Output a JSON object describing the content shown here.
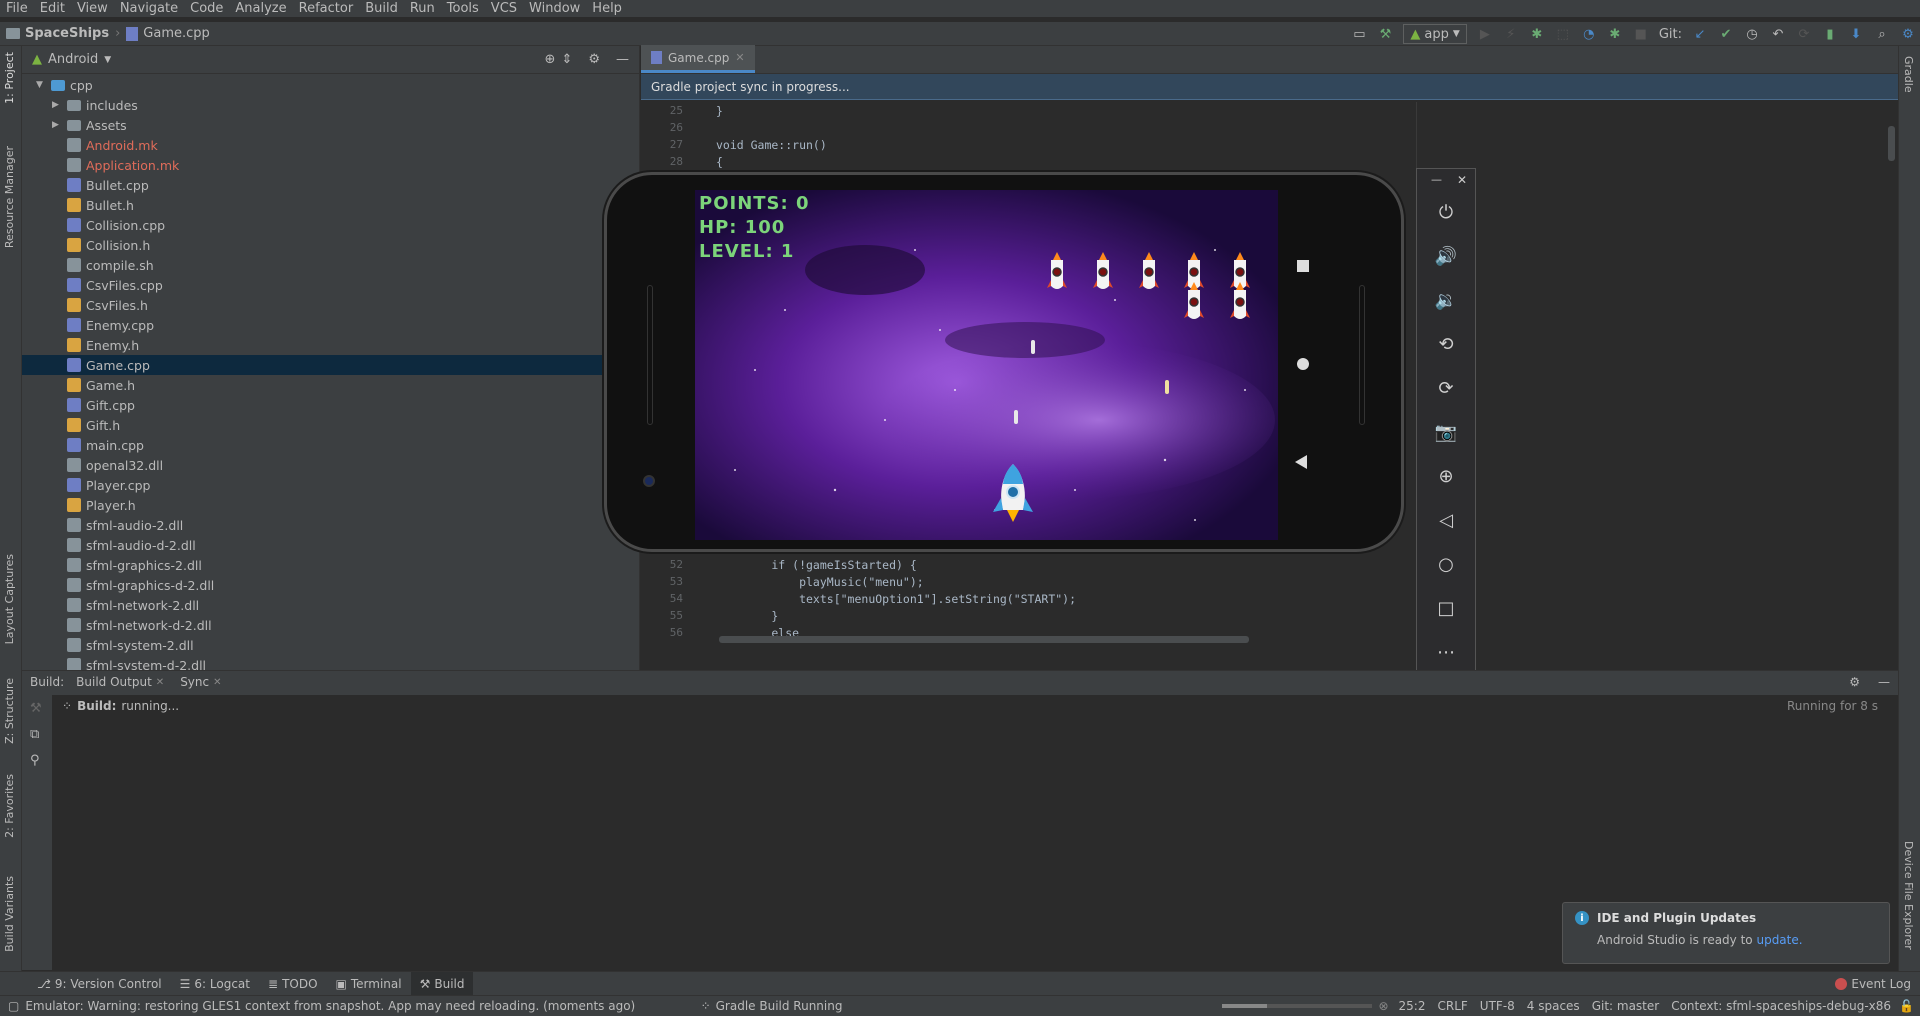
{
  "menu": [
    "File",
    "Edit",
    "View",
    "Navigate",
    "Code",
    "Analyze",
    "Refactor",
    "Build",
    "Run",
    "Tools",
    "VCS",
    "Window",
    "Help"
  ],
  "breadcrumb": {
    "project": "SpaceShips",
    "file": "Game.cpp"
  },
  "toolbar": {
    "run_config": "app",
    "git_label": "Git:"
  },
  "left_tabs": {
    "project": "1: Project",
    "resource_manager": "Resource Manager",
    "layout_captures": "Layout Captures",
    "structure": "Z: Structure",
    "favorites": "2: Favorites",
    "build_variants": "Build Variants"
  },
  "right_tabs": {
    "gradle": "Gradle",
    "device_file_explorer": "Device File Explorer"
  },
  "project": {
    "view_selector": "Android",
    "tree": [
      {
        "label": "cpp",
        "kind": "folder-open",
        "depth": 0,
        "color": "#bbbbbb"
      },
      {
        "label": "includes",
        "kind": "folder",
        "depth": 1,
        "color": "#bbbbbb"
      },
      {
        "label": "Assets",
        "kind": "folder",
        "depth": 1,
        "color": "#bbbbbb"
      },
      {
        "label": "Android.mk",
        "kind": "file",
        "depth": 1,
        "color": "#e06c5a"
      },
      {
        "label": "Application.mk",
        "kind": "file",
        "depth": 1,
        "color": "#e06c5a"
      },
      {
        "label": "Bullet.cpp",
        "kind": "cpp",
        "depth": 1,
        "color": "#bbbbbb"
      },
      {
        "label": "Bullet.h",
        "kind": "h",
        "depth": 1,
        "color": "#bbbbbb"
      },
      {
        "label": "Collision.cpp",
        "kind": "cpp",
        "depth": 1,
        "color": "#bbbbbb"
      },
      {
        "label": "Collision.h",
        "kind": "h",
        "depth": 1,
        "color": "#bbbbbb"
      },
      {
        "label": "compile.sh",
        "kind": "file",
        "depth": 1,
        "color": "#bbbbbb"
      },
      {
        "label": "CsvFiles.cpp",
        "kind": "cpp",
        "depth": 1,
        "color": "#bbbbbb"
      },
      {
        "label": "CsvFiles.h",
        "kind": "h",
        "depth": 1,
        "color": "#bbbbbb"
      },
      {
        "label": "Enemy.cpp",
        "kind": "cpp",
        "depth": 1,
        "color": "#bbbbbb"
      },
      {
        "label": "Enemy.h",
        "kind": "h",
        "depth": 1,
        "color": "#bbbbbb"
      },
      {
        "label": "Game.cpp",
        "kind": "cpp",
        "depth": 1,
        "color": "#bbbbbb",
        "selected": true
      },
      {
        "label": "Game.h",
        "kind": "h",
        "depth": 1,
        "color": "#bbbbbb"
      },
      {
        "label": "Gift.cpp",
        "kind": "cpp",
        "depth": 1,
        "color": "#bbbbbb"
      },
      {
        "label": "Gift.h",
        "kind": "h",
        "depth": 1,
        "color": "#bbbbbb"
      },
      {
        "label": "main.cpp",
        "kind": "cpp",
        "depth": 1,
        "color": "#bbbbbb"
      },
      {
        "label": "openal32.dll",
        "kind": "file",
        "depth": 1,
        "color": "#bbbbbb"
      },
      {
        "label": "Player.cpp",
        "kind": "cpp",
        "depth": 1,
        "color": "#bbbbbb"
      },
      {
        "label": "Player.h",
        "kind": "h",
        "depth": 1,
        "color": "#bbbbbb"
      },
      {
        "label": "sfml-audio-2.dll",
        "kind": "file",
        "depth": 1,
        "color": "#bbbbbb"
      },
      {
        "label": "sfml-audio-d-2.dll",
        "kind": "file",
        "depth": 1,
        "color": "#bbbbbb"
      },
      {
        "label": "sfml-graphics-2.dll",
        "kind": "file",
        "depth": 1,
        "color": "#bbbbbb"
      },
      {
        "label": "sfml-graphics-d-2.dll",
        "kind": "file",
        "depth": 1,
        "color": "#bbbbbb"
      },
      {
        "label": "sfml-network-2.dll",
        "kind": "file",
        "depth": 1,
        "color": "#bbbbbb"
      },
      {
        "label": "sfml-network-d-2.dll",
        "kind": "file",
        "depth": 1,
        "color": "#bbbbbb"
      },
      {
        "label": "sfml-system-2.dll",
        "kind": "file",
        "depth": 1,
        "color": "#bbbbbb"
      },
      {
        "label": "sfml-system-d-2.dll",
        "kind": "file",
        "depth": 1,
        "color": "#bbbbbb"
      }
    ]
  },
  "editor": {
    "tab": "Game.cpp",
    "sync_message": "Gradle project sync in progress...",
    "lines_top": [
      {
        "n": "25",
        "code": "}"
      },
      {
        "n": "26",
        "code": ""
      },
      {
        "n": "27",
        "code": "void Game::run()"
      },
      {
        "n": "28",
        "code": "{"
      }
    ],
    "lines_bottom": [
      {
        "n": "52",
        "code": "        if (!gameIsStarted) {"
      },
      {
        "n": "53",
        "code": "            playMusic(\"menu\");"
      },
      {
        "n": "54",
        "code": "            texts[\"menuOption1\"].setString(\"START\");"
      },
      {
        "n": "55",
        "code": "        }"
      },
      {
        "n": "56",
        "code": "        else"
      }
    ]
  },
  "game": {
    "points": "POINTS: 0",
    "hp": "HP: 100",
    "level": "LEVEL: 1"
  },
  "emulator_controls": [
    "power-icon",
    "volume-up-icon",
    "volume-down-icon",
    "rotate-left-icon",
    "rotate-right-icon",
    "camera-icon",
    "zoom-icon",
    "back-icon",
    "home-icon",
    "overview-icon",
    "more-icon"
  ],
  "build": {
    "label": "Build:",
    "tabs": [
      "Build Output",
      "Sync"
    ],
    "status_prefix": "Build:",
    "status": "running...",
    "elapsed": "Running for 8 s"
  },
  "bottom_tabs": [
    {
      "label": "9: Version Control"
    },
    {
      "label": "6: Logcat"
    },
    {
      "label": "TODO"
    },
    {
      "label": "Terminal"
    },
    {
      "label": "Build",
      "active": true
    }
  ],
  "event_log": "Event Log",
  "notification": {
    "title": "IDE and Plugin Updates",
    "body": "Android Studio is ready to",
    "link": "update."
  },
  "status": {
    "message": "Emulator: Warning: restoring GLES1 context from snapshot. App may need reloading. (moments ago)",
    "gradle": "Gradle Build Running",
    "position": "25:2",
    "line_sep": "CRLF",
    "encoding": "UTF-8",
    "indent": "4 spaces",
    "git": "Git: master",
    "context": "Context: sfml-spaceships-debug-x86"
  },
  "colors": {
    "accent": "#4a88c7",
    "selection": "#0d293e",
    "hud": "#7cd47a",
    "error": "#e06c5a"
  }
}
